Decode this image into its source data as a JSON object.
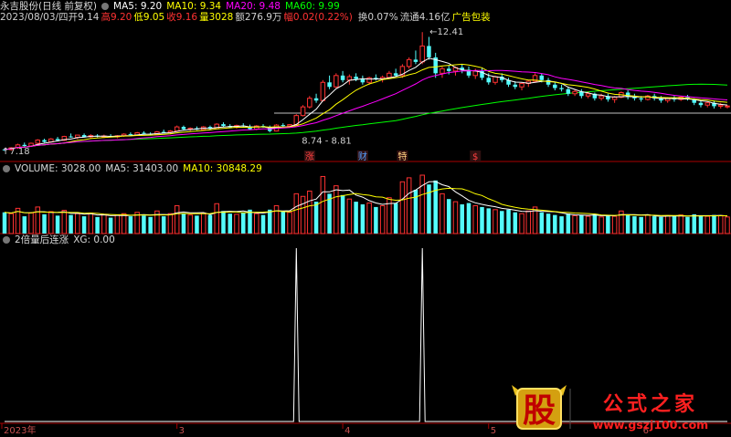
{
  "colors": {
    "up": "#ff3232",
    "down": "#54fcfc",
    "ma5": "#ffffff",
    "ma10": "#ffff00",
    "ma20": "#ff00ff",
    "ma60": "#00ff00",
    "axis": "#aa0000",
    "white": "#ffffff"
  },
  "header": {
    "stock": "永吉股份(日线 前复权)",
    "ma5": "MA5: 9.20",
    "ma10": "MA10: 9.34",
    "ma20": "MA20: 9.48",
    "ma60": "MA60: 9.99",
    "info_date": "2023/08/03/四",
    "info_open": "开9.14",
    "info_high": "高9.20",
    "info_low": "低9.05",
    "info_close": "收9.16",
    "info_vol": "量3028",
    "info_amount": "额276.9万",
    "info_change": "幅0.02(0.22%)",
    "info_turnover": "换0.07%",
    "info_float": "流通4.16亿",
    "info_ad": "广告包装"
  },
  "volume_header": {
    "volume": "VOLUME: 3028.00",
    "ma5": "MA5: 31403.00",
    "ma10": "MA10: 30848.29"
  },
  "indicator_header": {
    "name": "2倍量后连涨",
    "xg": "XG: 0.00"
  },
  "price_labels": {
    "high": "12.41",
    "range": "8.74 - 8.81",
    "low": "7.18"
  },
  "event_markers": [
    "涨",
    "财",
    "特",
    "$"
  ],
  "watermark": {
    "glyph": "股",
    "text": "公式之家",
    "url": "www.gszj100.com"
  },
  "chart_data": {
    "type": "candlestick",
    "x_ticks": [
      "2023年",
      "3",
      "4",
      "5",
      "6"
    ],
    "price_ylim": [
      7.0,
      12.7
    ],
    "candles": [
      [
        7.25,
        7.3,
        7.18,
        7.24
      ],
      [
        7.24,
        7.35,
        7.2,
        7.32
      ],
      [
        7.32,
        7.5,
        7.28,
        7.45
      ],
      [
        7.45,
        7.55,
        7.38,
        7.4
      ],
      [
        7.4,
        7.55,
        7.36,
        7.52
      ],
      [
        7.52,
        7.7,
        7.48,
        7.66
      ],
      [
        7.66,
        7.72,
        7.55,
        7.58
      ],
      [
        7.58,
        7.75,
        7.55,
        7.71
      ],
      [
        7.71,
        7.8,
        7.62,
        7.65
      ],
      [
        7.65,
        7.85,
        7.62,
        7.82
      ],
      [
        7.82,
        7.95,
        7.76,
        7.78
      ],
      [
        7.78,
        7.9,
        7.7,
        7.88
      ],
      [
        7.88,
        7.95,
        7.78,
        7.8
      ],
      [
        7.8,
        7.92,
        7.74,
        7.86
      ],
      [
        7.86,
        7.92,
        7.78,
        7.82
      ],
      [
        7.82,
        7.9,
        7.75,
        7.84
      ],
      [
        7.84,
        7.92,
        7.78,
        7.8
      ],
      [
        7.8,
        7.88,
        7.74,
        7.85
      ],
      [
        7.85,
        7.96,
        7.8,
        7.92
      ],
      [
        7.92,
        8.0,
        7.85,
        7.88
      ],
      [
        7.88,
        8.02,
        7.84,
        7.98
      ],
      [
        7.98,
        8.05,
        7.9,
        7.94
      ],
      [
        7.94,
        8.0,
        7.86,
        7.9
      ],
      [
        7.9,
        8.06,
        7.88,
        8.02
      ],
      [
        8.02,
        8.12,
        7.96,
        8.0
      ],
      [
        8.0,
        8.1,
        7.92,
        8.06
      ],
      [
        8.06,
        8.3,
        8.02,
        8.24
      ],
      [
        8.24,
        8.3,
        8.1,
        8.14
      ],
      [
        8.14,
        8.22,
        8.06,
        8.18
      ],
      [
        8.18,
        8.26,
        8.1,
        8.12
      ],
      [
        8.12,
        8.28,
        8.08,
        8.24
      ],
      [
        8.24,
        8.3,
        8.12,
        8.16
      ],
      [
        8.16,
        8.4,
        8.14,
        8.36
      ],
      [
        8.36,
        8.44,
        8.24,
        8.28
      ],
      [
        8.28,
        8.36,
        8.18,
        8.22
      ],
      [
        8.22,
        8.34,
        8.16,
        8.3
      ],
      [
        8.3,
        8.4,
        8.2,
        8.26
      ],
      [
        8.26,
        8.34,
        8.1,
        8.14
      ],
      [
        8.14,
        8.32,
        8.1,
        8.28
      ],
      [
        8.28,
        8.36,
        8.2,
        8.24
      ],
      [
        8.24,
        8.3,
        8.0,
        8.06
      ],
      [
        8.06,
        8.36,
        8.04,
        8.32
      ],
      [
        8.32,
        8.4,
        8.22,
        8.28
      ],
      [
        8.28,
        8.36,
        8.2,
        8.34
      ],
      [
        8.34,
        8.8,
        8.3,
        8.74
      ],
      [
        8.74,
        9.2,
        8.7,
        9.12
      ],
      [
        9.12,
        9.6,
        9.05,
        9.5
      ],
      [
        9.5,
        9.7,
        9.3,
        9.4
      ],
      [
        9.4,
        10.3,
        9.36,
        10.2
      ],
      [
        10.2,
        10.5,
        9.9,
        10.0
      ],
      [
        10.0,
        10.6,
        9.95,
        10.5
      ],
      [
        10.5,
        10.7,
        10.2,
        10.3
      ],
      [
        10.3,
        10.55,
        10.1,
        10.45
      ],
      [
        10.45,
        10.6,
        10.25,
        10.35
      ],
      [
        10.35,
        10.5,
        10.1,
        10.2
      ],
      [
        10.2,
        10.45,
        10.1,
        10.4
      ],
      [
        10.4,
        10.55,
        10.28,
        10.36
      ],
      [
        10.36,
        10.5,
        10.2,
        10.42
      ],
      [
        10.42,
        10.7,
        10.35,
        10.6
      ],
      [
        10.6,
        10.8,
        10.45,
        10.5
      ],
      [
        10.5,
        11.0,
        10.4,
        10.9
      ],
      [
        10.9,
        11.3,
        10.8,
        11.2
      ],
      [
        11.2,
        11.6,
        11.0,
        11.1
      ],
      [
        11.1,
        12.41,
        11.0,
        11.8
      ],
      [
        11.8,
        12.2,
        11.2,
        11.3
      ],
      [
        11.3,
        11.5,
        10.4,
        10.6
      ],
      [
        10.6,
        10.9,
        10.4,
        10.8
      ],
      [
        10.8,
        10.95,
        10.55,
        10.7
      ],
      [
        10.7,
        10.9,
        10.5,
        10.85
      ],
      [
        10.85,
        11.0,
        10.6,
        10.75
      ],
      [
        10.75,
        10.9,
        10.4,
        10.5
      ],
      [
        10.5,
        10.8,
        10.35,
        10.7
      ],
      [
        10.7,
        10.85,
        10.3,
        10.4
      ],
      [
        10.4,
        10.6,
        10.1,
        10.2
      ],
      [
        10.2,
        10.5,
        10.1,
        10.45
      ],
      [
        10.45,
        10.6,
        10.2,
        10.3
      ],
      [
        10.3,
        10.4,
        10.0,
        10.1
      ],
      [
        10.1,
        10.25,
        9.9,
        10.0
      ],
      [
        10.0,
        10.2,
        9.85,
        10.15
      ],
      [
        10.15,
        10.3,
        10.0,
        10.25
      ],
      [
        10.25,
        10.6,
        10.2,
        10.5
      ],
      [
        10.5,
        10.6,
        10.2,
        10.3
      ],
      [
        10.3,
        10.4,
        10.0,
        10.1
      ],
      [
        10.1,
        10.2,
        9.85,
        9.95
      ],
      [
        9.95,
        10.1,
        9.8,
        9.9
      ],
      [
        9.9,
        10.0,
        9.6,
        9.7
      ],
      [
        9.7,
        9.9,
        9.6,
        9.8
      ],
      [
        9.8,
        9.9,
        9.5,
        9.6
      ],
      [
        9.6,
        9.8,
        9.5,
        9.7
      ],
      [
        9.7,
        9.75,
        9.4,
        9.5
      ],
      [
        9.5,
        9.7,
        9.4,
        9.6
      ],
      [
        9.6,
        9.7,
        9.35,
        9.45
      ],
      [
        9.45,
        9.6,
        9.3,
        9.55
      ],
      [
        9.55,
        9.8,
        9.5,
        9.75
      ],
      [
        9.75,
        9.85,
        9.45,
        9.55
      ],
      [
        9.55,
        9.7,
        9.4,
        9.5
      ],
      [
        9.5,
        9.6,
        9.35,
        9.45
      ],
      [
        9.45,
        9.65,
        9.4,
        9.6
      ],
      [
        9.6,
        9.7,
        9.4,
        9.5
      ],
      [
        9.5,
        9.6,
        9.3,
        9.4
      ],
      [
        9.4,
        9.55,
        9.3,
        9.5
      ],
      [
        9.5,
        9.6,
        9.35,
        9.45
      ],
      [
        9.45,
        9.6,
        9.38,
        9.55
      ],
      [
        9.55,
        9.65,
        9.4,
        9.45
      ],
      [
        9.45,
        9.5,
        9.2,
        9.3
      ],
      [
        9.3,
        9.4,
        9.1,
        9.2
      ],
      [
        9.2,
        9.35,
        9.1,
        9.3
      ],
      [
        9.3,
        9.4,
        9.05,
        9.15
      ],
      [
        9.15,
        9.3,
        9.05,
        9.2
      ],
      [
        9.14,
        9.2,
        9.05,
        9.16
      ]
    ],
    "volumes": [
      3.2,
      3.0,
      3.8,
      2.6,
      3.1,
      4.0,
      2.9,
      3.3,
      2.7,
      3.5,
      2.8,
      3.0,
      2.6,
      3.1,
      2.5,
      2.9,
      2.4,
      2.8,
      3.0,
      2.6,
      3.2,
      2.7,
      2.5,
      3.4,
      2.6,
      3.0,
      4.2,
      3.0,
      2.8,
      2.7,
      3.1,
      2.8,
      4.5,
      3.4,
      3.0,
      2.9,
      3.2,
      3.6,
      3.0,
      2.8,
      3.6,
      4.2,
      3.4,
      3.2,
      6.0,
      5.6,
      6.4,
      4.8,
      8.6,
      6.0,
      7.2,
      5.8,
      5.2,
      4.8,
      4.4,
      4.6,
      4.0,
      4.2,
      5.4,
      4.6,
      7.8,
      8.4,
      6.6,
      8.8,
      7.4,
      8.0,
      6.0,
      5.2,
      4.8,
      4.4,
      4.6,
      4.2,
      4.0,
      3.8,
      3.6,
      3.4,
      3.6,
      3.2,
      3.0,
      3.4,
      4.0,
      3.2,
      3.0,
      2.8,
      2.6,
      3.0,
      2.7,
      2.8,
      2.6,
      2.9,
      2.5,
      2.8,
      2.6,
      3.4,
      2.9,
      2.6,
      2.5,
      2.8,
      2.6,
      2.5,
      2.7,
      2.6,
      2.8,
      2.5,
      2.9,
      2.7,
      2.6,
      2.8,
      2.7,
      2.5
    ],
    "indicator_spikes": [
      44,
      63
    ]
  }
}
